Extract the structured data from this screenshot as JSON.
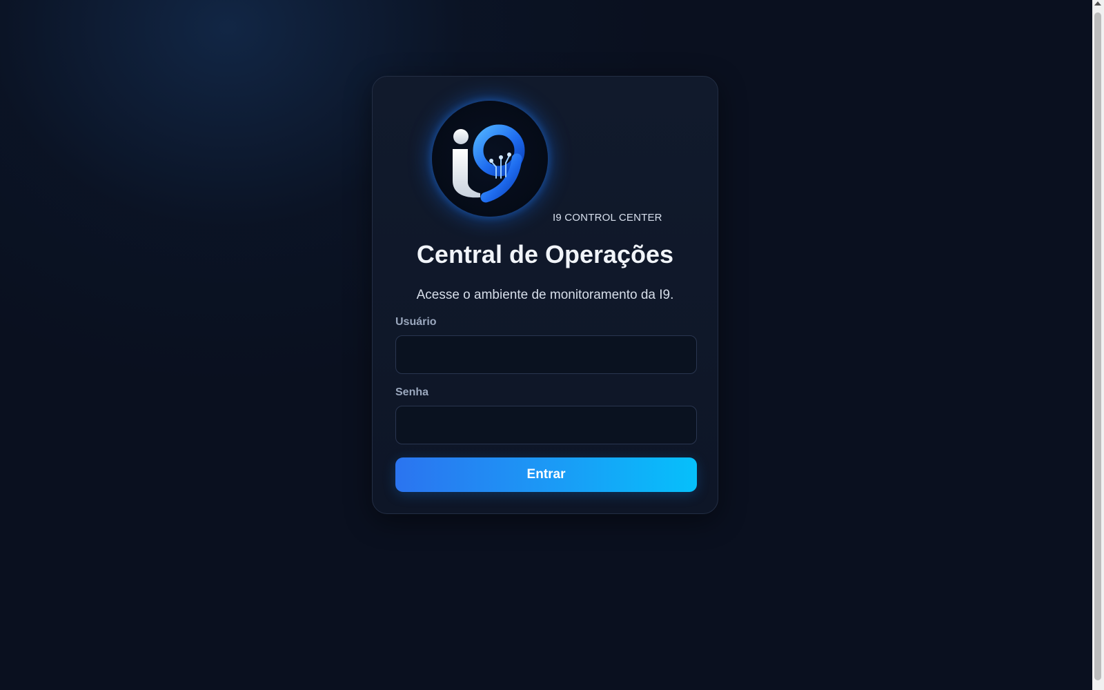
{
  "brand": {
    "logo_icon": "i9-logo-icon",
    "logo_text": "i9",
    "tagline": "I9 CONTROL CENTER"
  },
  "login": {
    "title": "Central de Operações",
    "subtitle": "Acesse o ambiente de monitoramento da I9.",
    "username_label": "Usuário",
    "username_value": "",
    "password_label": "Senha",
    "password_value": "",
    "submit_label": "Entrar"
  },
  "colors": {
    "background": "#0a101f",
    "card": "#111a2c",
    "accent_start": "#2b74f0",
    "accent_end": "#06c0fb",
    "label": "#9aa7bd"
  }
}
